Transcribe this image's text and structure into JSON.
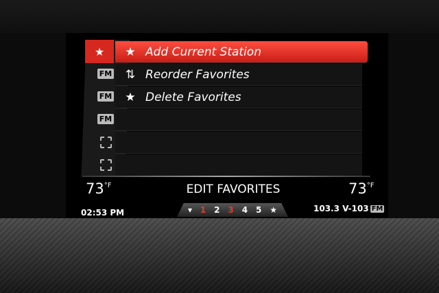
{
  "sidebar": {
    "items": [
      {
        "type": "star",
        "icon": "star-pin-icon",
        "label": ""
      },
      {
        "type": "fm",
        "label": "FM"
      },
      {
        "type": "fm",
        "label": "FM"
      },
      {
        "type": "fm",
        "label": "FM"
      },
      {
        "type": "empty",
        "label": ""
      },
      {
        "type": "empty",
        "label": ""
      }
    ]
  },
  "menu": {
    "items": [
      {
        "label": "Add Current Station",
        "icon": "add-star-icon",
        "glyph": "★"
      },
      {
        "label": "Reorder Favorites",
        "icon": "reorder-icon",
        "glyph": "⇅"
      },
      {
        "label": "Delete Favorites",
        "icon": "delete-star-icon",
        "glyph": "★"
      }
    ]
  },
  "status": {
    "left_temp": "73",
    "right_temp": "73",
    "temp_unit": "°F",
    "title": "EDIT FAVORITES",
    "time": "02:53 PM",
    "station": "103.3 V-103",
    "station_band": "FM"
  },
  "presets": {
    "items": [
      "▾",
      "1",
      "2",
      "3",
      "4",
      "5",
      "★"
    ],
    "highlighted": [
      1,
      3
    ]
  },
  "colors": {
    "accent": "#d7281f"
  }
}
